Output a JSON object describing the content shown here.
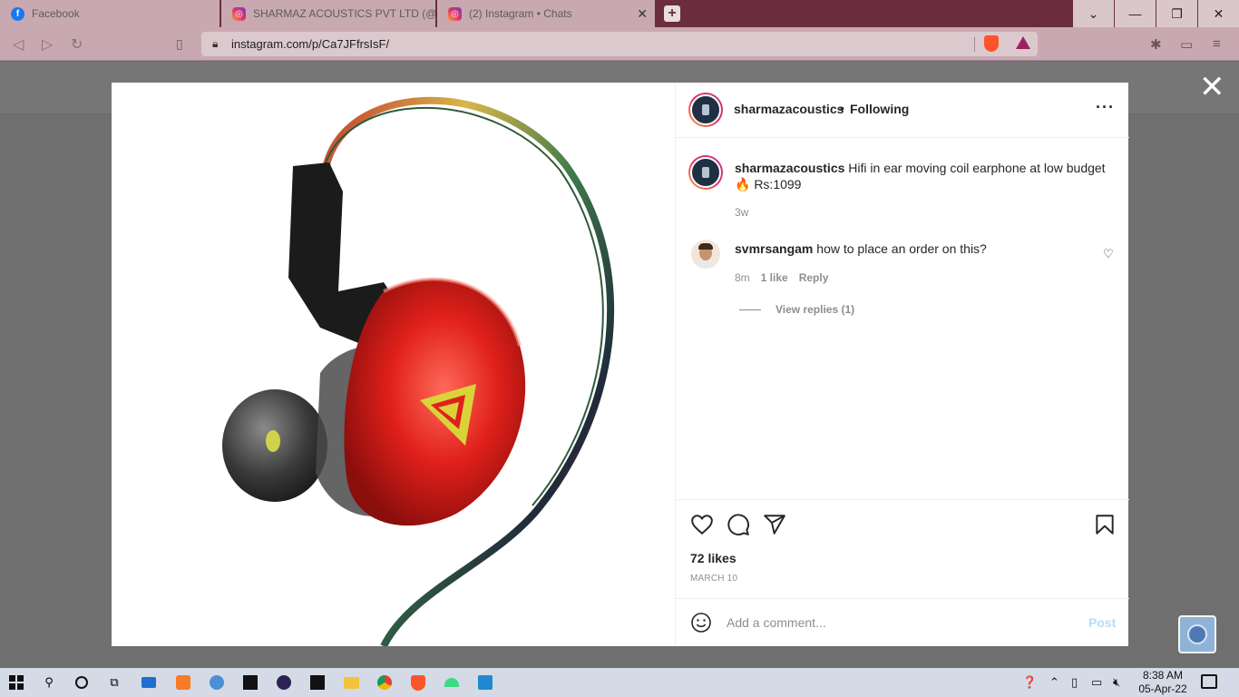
{
  "browser": {
    "tabs": [
      {
        "title": "Facebook"
      },
      {
        "title": "SHARMAZ ACOUSTICS PVT LTD (@sha"
      },
      {
        "title": "(2) Instagram • Chats"
      }
    ],
    "url": "instagram.com/p/Ca7JFfrsIsF/"
  },
  "post": {
    "header": {
      "username": "sharmazacoustics",
      "dot": "•",
      "follow_state": "Following"
    },
    "caption": {
      "username": "sharmazacoustics",
      "text": "Hifi in ear moving coil earphone at low budget🔥 Rs:1099",
      "time": "3w"
    },
    "comments": [
      {
        "username": "svmrsangam",
        "text": "how to place an order on this?",
        "time": "8m",
        "likes": "1 like",
        "reply_label": "Reply",
        "view_replies": "View replies (1)"
      }
    ],
    "likes_text": "72 likes",
    "date": "MARCH 10",
    "comment_input": {
      "placeholder": "Add a comment..."
    },
    "post_button": "Post"
  },
  "taskbar": {
    "time": "8:38 AM",
    "date": "05-Apr-22"
  },
  "colors": {
    "browser_frame": "#6b2c3e",
    "toolbar": "#c9a9b1",
    "instagram_blue_disabled": "#b2dffc",
    "text_primary": "#262626",
    "text_secondary": "#8e8e8e"
  }
}
